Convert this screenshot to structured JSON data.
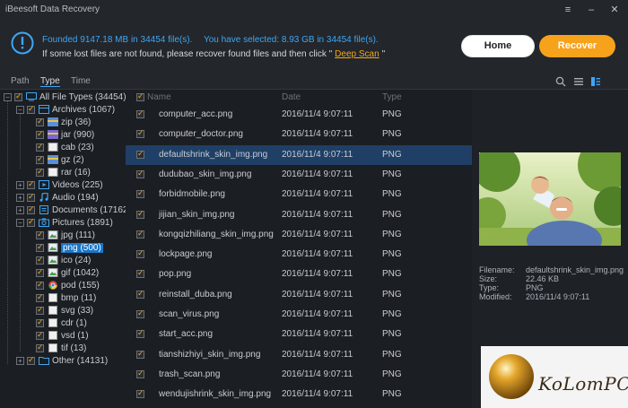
{
  "app": {
    "title": "iBeesoft Data Recovery"
  },
  "header": {
    "found_text": "Founded 9147.18 MB in 34454 file(s).",
    "selected_text": "You have selected: 8.93 GB in 34454 file(s).",
    "hint_before": "If some lost files are not found, please recover found files and then click \"",
    "hint_link": "Deep Scan",
    "hint_after": "\"",
    "home_label": "Home",
    "recover_label": "Recover"
  },
  "tabs": [
    {
      "label": "Path"
    },
    {
      "label": "Type"
    },
    {
      "label": "Time"
    }
  ],
  "tree": {
    "root": "All File Types (34454)",
    "archives": "Archives (1067)",
    "archive_children": [
      "zip (36)",
      "jar (990)",
      "cab (23)",
      "gz (2)",
      "rar (16)"
    ],
    "videos": "Videos (225)",
    "audio": "Audio (194)",
    "documents": "Documents (17162)",
    "pictures": "Pictures (1891)",
    "picture_children": [
      "jpg (111)",
      "png (500)",
      "ico (24)",
      "gif (1042)",
      "pod (155)",
      "bmp (11)",
      "svg (33)",
      "cdr (1)",
      "vsd (1)",
      "tif (13)"
    ],
    "other": "Other (14131)"
  },
  "list": {
    "columns": {
      "name": "Name",
      "date": "Date",
      "type": "Type"
    },
    "rows": [
      {
        "name": "computer_acc.png",
        "date": "2016/11/4 9:07:11",
        "type": "PNG"
      },
      {
        "name": "computer_doctor.png",
        "date": "2016/11/4 9:07:11",
        "type": "PNG"
      },
      {
        "name": "defaultshrink_skin_img.png",
        "date": "2016/11/4 9:07:11",
        "type": "PNG"
      },
      {
        "name": "dudubao_skin_img.png",
        "date": "2016/11/4 9:07:11",
        "type": "PNG"
      },
      {
        "name": "forbidmobile.png",
        "date": "2016/11/4 9:07:11",
        "type": "PNG"
      },
      {
        "name": "jijian_skin_img.png",
        "date": "2016/11/4 9:07:11",
        "type": "PNG"
      },
      {
        "name": "kongqizhiliang_skin_img.png",
        "date": "2016/11/4 9:07:11",
        "type": "PNG"
      },
      {
        "name": "lockpage.png",
        "date": "2016/11/4 9:07:11",
        "type": "PNG"
      },
      {
        "name": "pop.png",
        "date": "2016/11/4 9:07:11",
        "type": "PNG"
      },
      {
        "name": "reinstall_duba.png",
        "date": "2016/11/4 9:07:11",
        "type": "PNG"
      },
      {
        "name": "scan_virus.png",
        "date": "2016/11/4 9:07:11",
        "type": "PNG"
      },
      {
        "name": "start_acc.png",
        "date": "2016/11/4 9:07:11",
        "type": "PNG"
      },
      {
        "name": "tianshizhiyi_skin_img.png",
        "date": "2016/11/4 9:07:11",
        "type": "PNG"
      },
      {
        "name": "trash_scan.png",
        "date": "2016/11/4 9:07:11",
        "type": "PNG"
      },
      {
        "name": "wendujishrink_skin_img.png",
        "date": "2016/11/4 9:07:11",
        "type": "PNG"
      }
    ]
  },
  "preview": {
    "filename_label": "Filename:",
    "filename": "defaultshrink_skin_img.png",
    "size_label": "Size:",
    "size": "22.46 KB",
    "type_label": "Type:",
    "type": "PNG",
    "modified_label": "Modified:",
    "modified": "2016/11/4 9:07:11"
  },
  "watermark": {
    "text": "KoLomPC"
  },
  "colors": {
    "accent": "#3ea6f5",
    "recover": "#f7a21b",
    "link": "#f2a81e",
    "selected_row": "#1f3f66"
  }
}
